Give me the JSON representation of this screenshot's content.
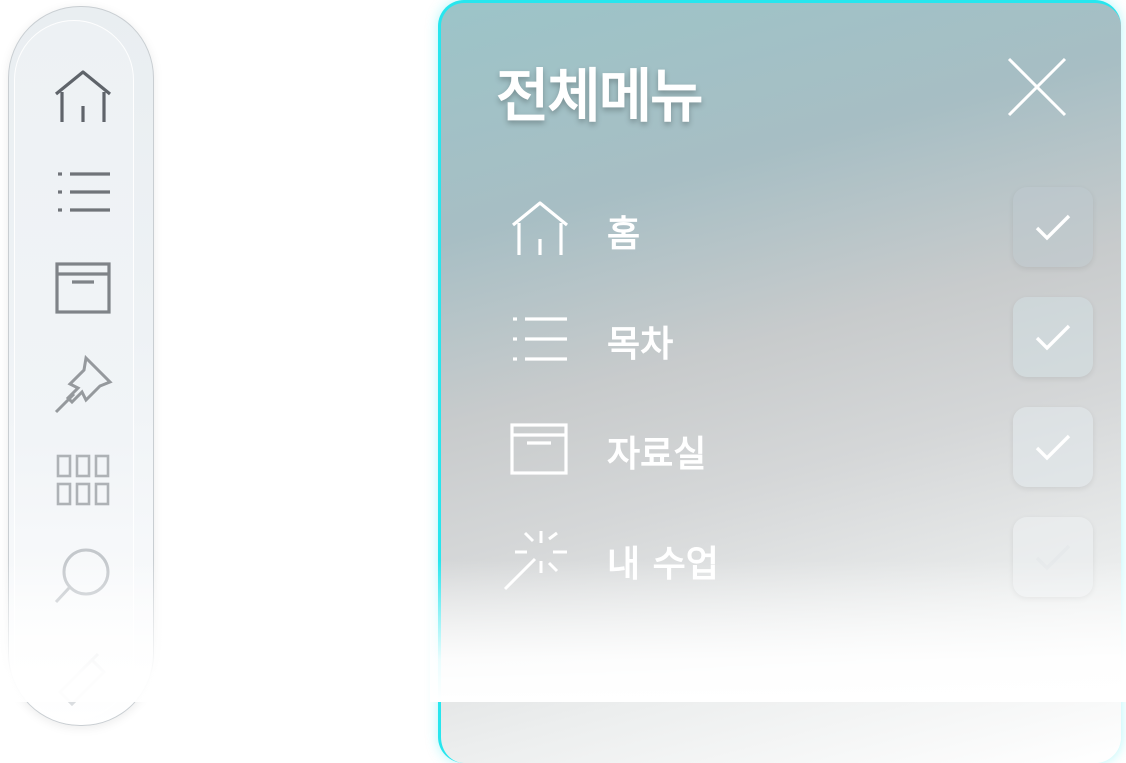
{
  "sidebar": {
    "items": [
      {
        "icon": "home-icon"
      },
      {
        "icon": "list-icon"
      },
      {
        "icon": "archive-icon"
      },
      {
        "icon": "pin-icon"
      },
      {
        "icon": "grid-icon"
      },
      {
        "icon": "search-icon"
      },
      {
        "icon": "pencil-icon"
      }
    ]
  },
  "menu": {
    "title": "전체메뉴",
    "close_icon": "close-icon",
    "items": [
      {
        "label": "홈",
        "icon": "home-icon",
        "checked": true
      },
      {
        "label": "목차",
        "icon": "list-icon",
        "checked": true
      },
      {
        "label": "자료실",
        "icon": "archive-icon",
        "checked": true
      },
      {
        "label": "내 수업",
        "icon": "magic-wand-icon",
        "checked": true
      }
    ]
  },
  "colors": {
    "panel_border": "#27e6ee",
    "rail_icon_dark": "#5f646a",
    "rail_icon_light": "#c9cdd1",
    "menu_text": "#ffffff"
  }
}
